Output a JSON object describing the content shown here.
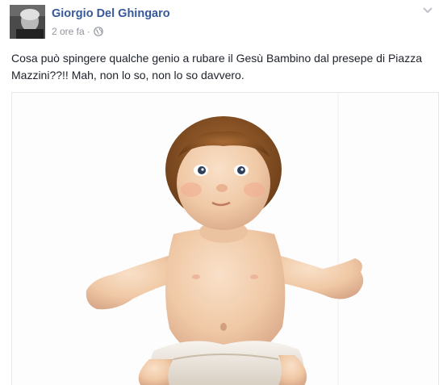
{
  "post": {
    "author_name": "Giorgio Del Ghingaro",
    "timestamp": "2 ore fa",
    "separator": "·",
    "privacy_icon": "globe-icon",
    "menu_icon": "chevron-down-icon",
    "text": "Cosa può spingere qualche genio a rubare il Gesù Bambino dal presepe di Piazza Mazzini??!! Mah, non lo so, non lo so davvero.",
    "colors": {
      "author": "#365899",
      "meta": "#90949c",
      "body_text": "#1d2129"
    }
  }
}
